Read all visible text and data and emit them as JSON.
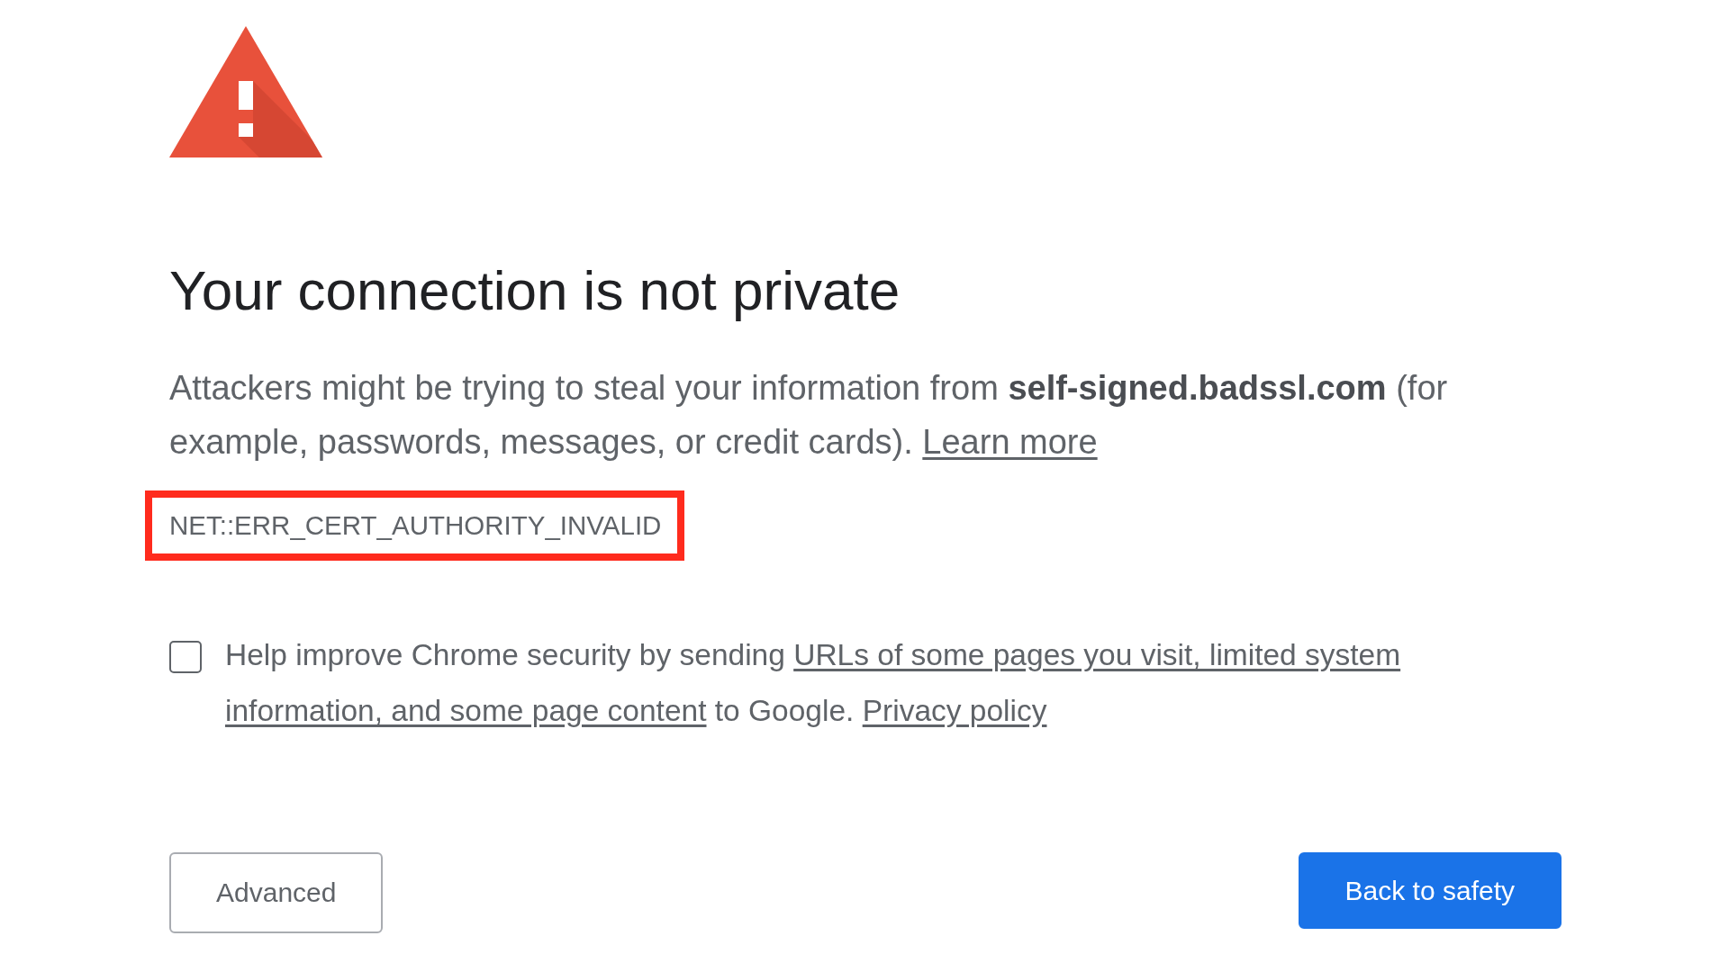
{
  "heading": "Your connection is not private",
  "explanation": {
    "text": "Attackers might be trying to steal your information from **self-signed.badssl.com** (for example, passwords, messages, or credit cards).",
    "link": "Learn more"
  },
  "error_code": {
    "text": "NET::ERR_CERT_AUTHORITY_INVALID",
    "highlighted": true
  },
  "opt_in": {
    "checked": false,
    "text_before": "Help improve Chrome security by sending",
    "link_parts": [
      "URLs of some pages you visit, limited system",
      "information, and some page content"
    ],
    "text_after": "to Google.",
    "privacy_link": "Privacy policy"
  },
  "buttons": [
    {
      "label": "Advanced",
      "kind": "secondary"
    },
    {
      "label": "Back to safety",
      "kind": "primary"
    }
  ]
}
